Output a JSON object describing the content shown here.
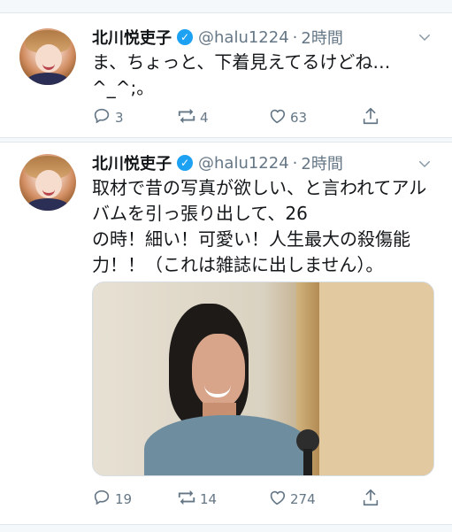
{
  "tweets": [
    {
      "name": "北川悦吏子",
      "handle": "@halu1224",
      "separator": "·",
      "time": "2時間",
      "text": "ま、ちょっと、下着見えてるけどね…\n^_^;。",
      "reply_count": "3",
      "retweet_count": "4",
      "like_count": "63"
    },
    {
      "name": "北川悦吏子",
      "handle": "@halu1224",
      "separator": "·",
      "time": "2時間",
      "text": "取材で昔の写真が欲しい、と言われてアルバムを引っ張り出して、26\nの時！細い！可愛い！人生最大の殺傷能力！！（これは雑誌に出しません）。",
      "reply_count": "19",
      "retweet_count": "14",
      "like_count": "274"
    }
  ],
  "icons": {
    "verified": "verified-badge-icon",
    "reply": "reply-icon",
    "retweet": "retweet-icon",
    "like": "like-icon",
    "share": "share-icon",
    "menu": "chevron-down-icon"
  },
  "colors": {
    "verified_blue": "#1da1f2",
    "secondary_text": "#657786",
    "primary_text": "#14171a"
  }
}
